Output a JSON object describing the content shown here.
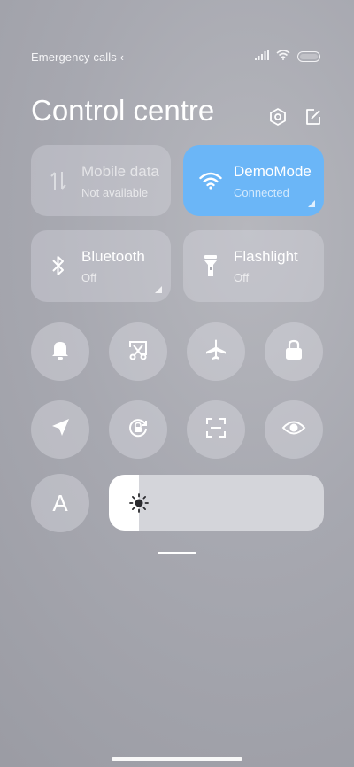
{
  "status_bar": {
    "carrier": "Emergency calls ‹",
    "signal_icon": "signal-bars-icon",
    "wifi_icon": "wifi-icon",
    "battery_icon": "battery-icon"
  },
  "header": {
    "title": "Control centre",
    "settings_icon": "settings-hexagon-icon",
    "edit_icon": "edit-icon"
  },
  "tiles": [
    {
      "label": "Mobile data",
      "status": "Not available",
      "icon": "mobile-data-arrows-icon",
      "active": false
    },
    {
      "label": "DemoMode",
      "status": "Connected",
      "icon": "wifi-icon",
      "active": true
    },
    {
      "label": "Bluetooth",
      "status": "Off",
      "icon": "bluetooth-icon",
      "active": false
    },
    {
      "label": "Flashlight",
      "status": "Off",
      "icon": "flashlight-icon",
      "active": false
    }
  ],
  "toggles_row1": [
    {
      "icon": "bell-icon"
    },
    {
      "icon": "screenshot-scissors-icon"
    },
    {
      "icon": "airplane-icon"
    },
    {
      "icon": "lock-icon"
    }
  ],
  "toggles_row2": [
    {
      "icon": "location-arrow-icon"
    },
    {
      "icon": "rotation-lock-icon"
    },
    {
      "icon": "scan-frame-icon"
    },
    {
      "icon": "eye-icon"
    }
  ],
  "auto_brightness": {
    "letter": "A"
  },
  "brightness": {
    "level_fraction": 0.14,
    "icon": "sun-icon"
  },
  "colors": {
    "accent_blue": "#6bb6f7",
    "tile_grey": "rgba(220,220,226,0.36)"
  }
}
